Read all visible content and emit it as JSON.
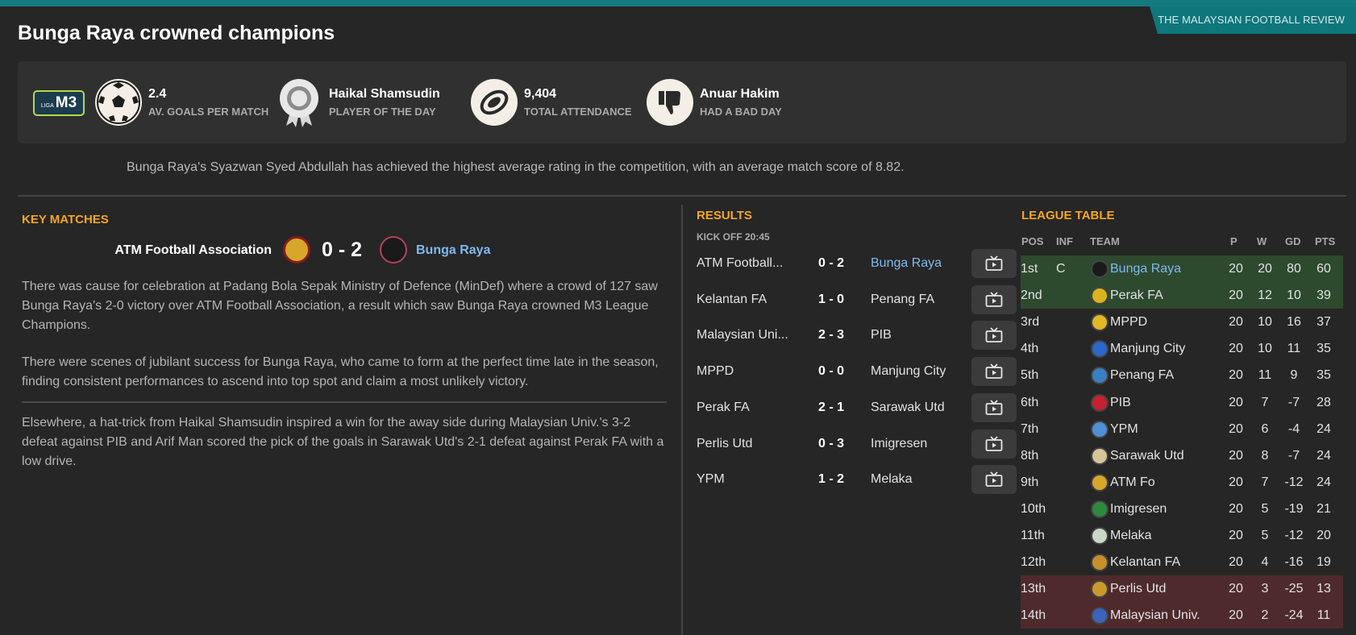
{
  "brand": "THE MALAYSIAN FOOTBALL REVIEW",
  "title": "Bunga Raya crowned champions",
  "league_logo": {
    "top": "LIGA",
    "main": "M3"
  },
  "stats": [
    {
      "value": "2.4",
      "label": "AV. GOALS PER MATCH",
      "icon": "football-icon"
    },
    {
      "value": "Haikal Shamsudin",
      "label": "PLAYER OF THE DAY",
      "icon": "award-rosette-icon"
    },
    {
      "value": "9,404",
      "label": "TOTAL ATTENDANCE",
      "icon": "stadium-icon"
    },
    {
      "value": "Anuar Hakim",
      "label": "HAD A BAD DAY",
      "icon": "thumbs-down-icon"
    }
  ],
  "summary": "Bunga Raya's Syazwan Syed Abdullah has achieved the highest average rating in the competition, with an average match score of 8.82.",
  "key_matches": {
    "heading": "KEY MATCHES",
    "home": "ATM Football Association",
    "score": "0 - 2",
    "away": "Bunga Raya",
    "paragraphs": [
      "There was cause for celebration at Padang Bola Sepak Ministry of Defence (MinDef) where a crowd of 127 saw Bunga Raya's 2-0 victory over ATM Football Association, a result which saw Bunga Raya crowned M3 League Champions.",
      "There were scenes of jubilant success for Bunga Raya, who came to form at the perfect time late in the season, finding consistent performances to ascend into top spot and claim a most unlikely victory.",
      "Elsewhere, a hat-trick from Haikal Shamsudin inspired a win for the away side during Malaysian Univ.'s 3-2 defeat against PIB and Arif Man scored the pick of the goals in Sarawak Utd's 2-1 defeat against Perak FA with a low drive."
    ]
  },
  "results": {
    "heading": "RESULTS",
    "kickoff": "KICK OFF 20:45",
    "rows": [
      {
        "home": "ATM Football...",
        "score": "0 - 2",
        "away": "Bunga Raya"
      },
      {
        "home": "Kelantan FA",
        "score": "1 - 0",
        "away": "Penang FA"
      },
      {
        "home": "Malaysian Uni...",
        "score": "2 - 3",
        "away": "PIB"
      },
      {
        "home": "MPPD",
        "score": "0 - 0",
        "away": "Manjung City"
      },
      {
        "home": "Perak FA",
        "score": "2 - 1",
        "away": "Sarawak Utd"
      },
      {
        "home": "Perlis Utd",
        "score": "0 - 3",
        "away": "Imigresen"
      },
      {
        "home": "YPM",
        "score": "1 - 2",
        "away": "Melaka"
      }
    ]
  },
  "league_table": {
    "heading": "LEAGUE TABLE",
    "columns": [
      "POS",
      "INF",
      "TEAM",
      "P",
      "W",
      "GD",
      "PTS"
    ],
    "rows": [
      {
        "pos": "1st",
        "inf": "C",
        "team": "Bunga Raya",
        "p": "20",
        "w": "20",
        "gd": "80",
        "pts": "60"
      },
      {
        "pos": "2nd",
        "inf": "",
        "team": "Perak FA",
        "p": "20",
        "w": "12",
        "gd": "10",
        "pts": "39"
      },
      {
        "pos": "3rd",
        "inf": "",
        "team": "MPPD",
        "p": "20",
        "w": "10",
        "gd": "16",
        "pts": "37"
      },
      {
        "pos": "4th",
        "inf": "",
        "team": "Manjung City",
        "p": "20",
        "w": "10",
        "gd": "11",
        "pts": "35"
      },
      {
        "pos": "5th",
        "inf": "",
        "team": "Penang FA",
        "p": "20",
        "w": "11",
        "gd": "9",
        "pts": "35"
      },
      {
        "pos": "6th",
        "inf": "",
        "team": "PIB",
        "p": "20",
        "w": "7",
        "gd": "-7",
        "pts": "28"
      },
      {
        "pos": "7th",
        "inf": "",
        "team": "YPM",
        "p": "20",
        "w": "6",
        "gd": "-4",
        "pts": "24"
      },
      {
        "pos": "8th",
        "inf": "",
        "team": "Sarawak Utd",
        "p": "20",
        "w": "8",
        "gd": "-7",
        "pts": "24"
      },
      {
        "pos": "9th",
        "inf": "",
        "team": "ATM Fo",
        "p": "20",
        "w": "7",
        "gd": "-12",
        "pts": "24"
      },
      {
        "pos": "10th",
        "inf": "",
        "team": "Imigresen",
        "p": "20",
        "w": "5",
        "gd": "-19",
        "pts": "21"
      },
      {
        "pos": "11th",
        "inf": "",
        "team": "Melaka",
        "p": "20",
        "w": "5",
        "gd": "-12",
        "pts": "20"
      },
      {
        "pos": "12th",
        "inf": "",
        "team": "Kelantan FA",
        "p": "20",
        "w": "4",
        "gd": "-16",
        "pts": "19"
      },
      {
        "pos": "13th",
        "inf": "",
        "team": "Perlis Utd",
        "p": "20",
        "w": "3",
        "gd": "-25",
        "pts": "13"
      },
      {
        "pos": "14th",
        "inf": "",
        "team": "Malaysian Univ.",
        "p": "20",
        "w": "2",
        "gd": "-24",
        "pts": "11"
      }
    ]
  },
  "colors": {
    "accent": "#f5a623",
    "link": "#7fb9f0",
    "brand": "#0f767c",
    "promotion": "#2d4a2f",
    "relegation": "#4f2a2c"
  }
}
